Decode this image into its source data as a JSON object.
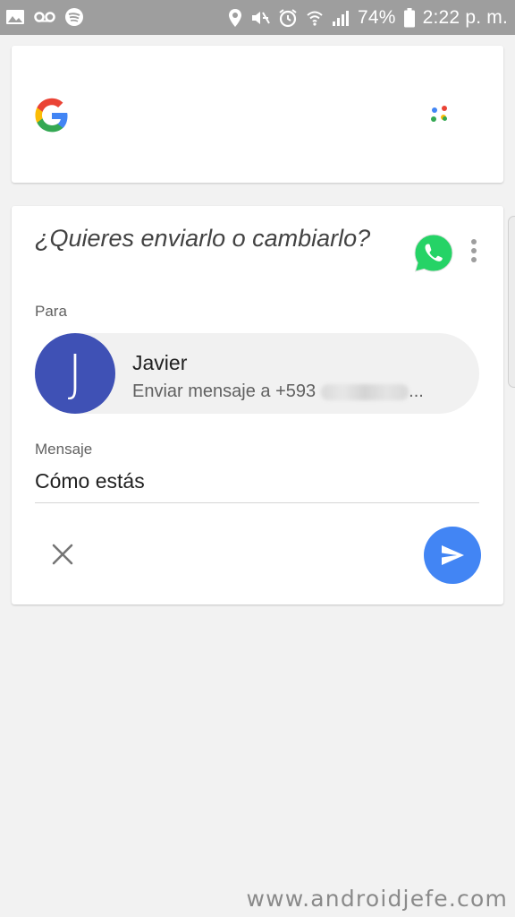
{
  "status_bar": {
    "battery": "74%",
    "time": "2:22 p. m.",
    "icons_left": [
      "image-icon",
      "voicemail-icon",
      "spotify-icon"
    ],
    "icons_right": [
      "location-icon",
      "mute-icon",
      "alarm-icon",
      "wifi-icon",
      "signal-icon",
      "battery-icon"
    ]
  },
  "assistant_card": {
    "logo": "google-g-icon",
    "assistant_icon": "assistant-dots-icon"
  },
  "message_card": {
    "question": "¿Quieres enviarlo o cambiarlo?",
    "app_icon": "whatsapp-icon",
    "to_label": "Para",
    "contact": {
      "initial": "J",
      "name": "Javier",
      "subtitle": "Enviar mensaje a +593"
    },
    "message_label": "Mensaje",
    "message_value": "Cómo estás"
  },
  "colors": {
    "avatar": "#3f51b5",
    "send_button": "#4285f4",
    "whatsapp": "#25d366",
    "status_bar": "#9e9e9e"
  },
  "watermark": "www.androidjefe.com"
}
